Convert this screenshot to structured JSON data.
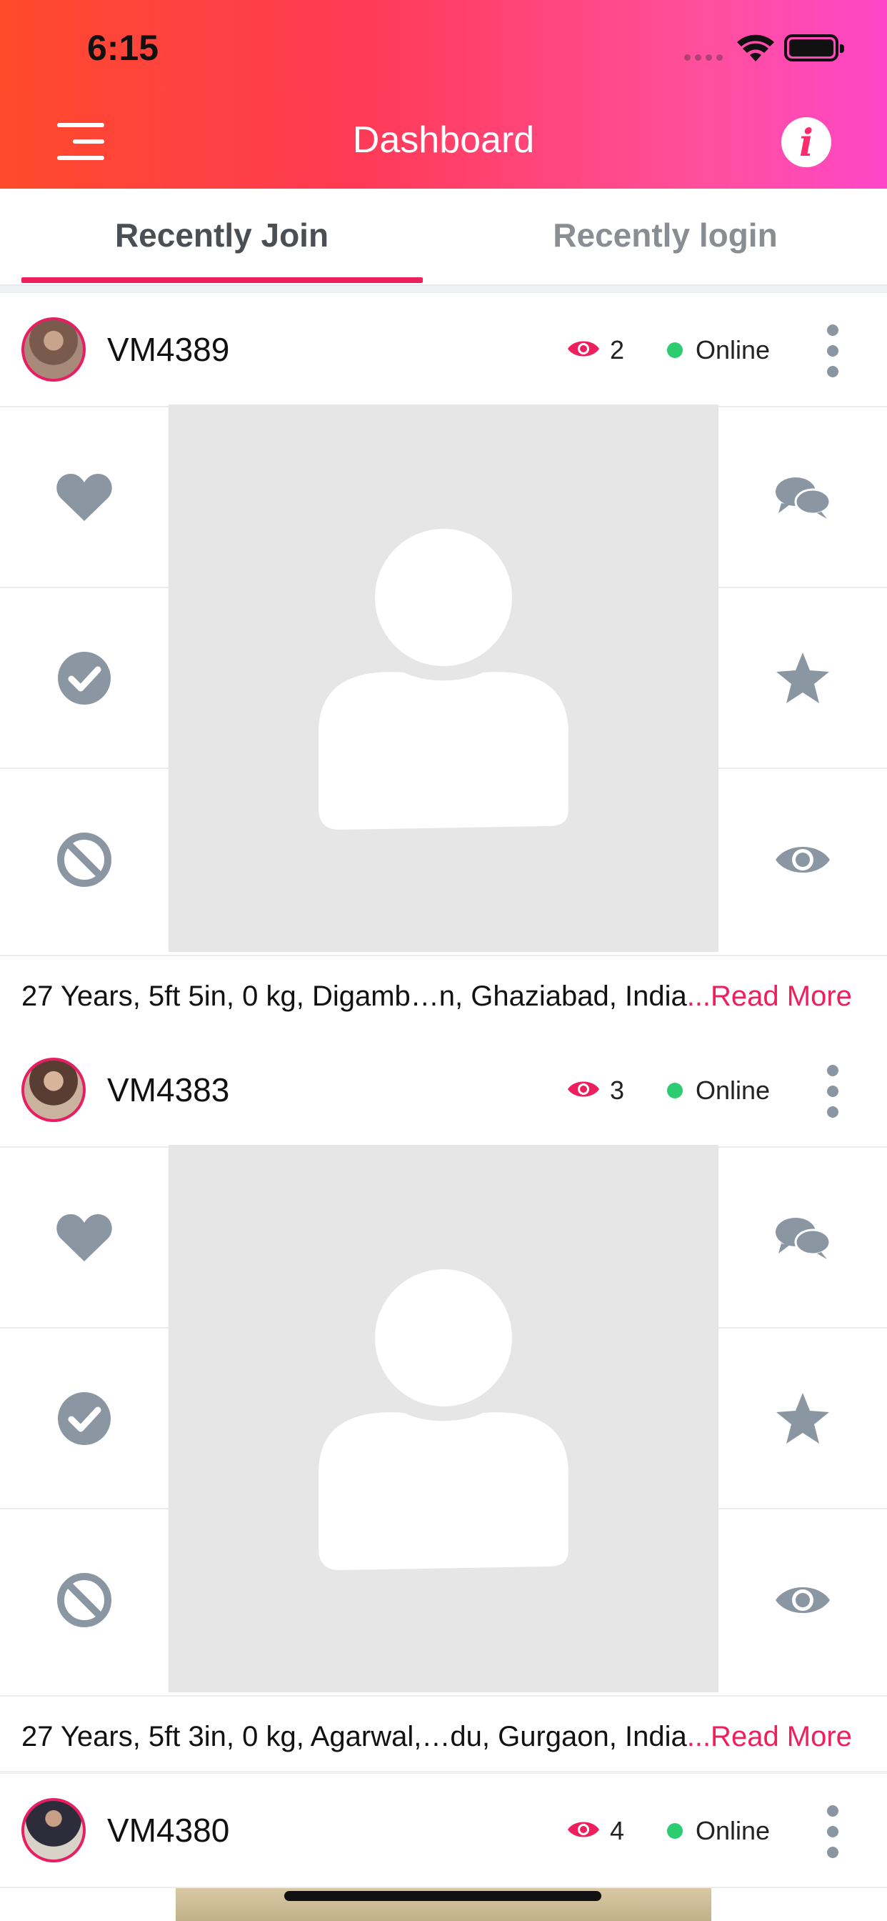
{
  "status_bar": {
    "time": "6:15"
  },
  "header": {
    "title": "Dashboard",
    "menu_icon": "hamburger-menu-icon",
    "info_icon": "info-icon",
    "info_glyph": "i"
  },
  "tabs": [
    {
      "label": "Recently Join",
      "active": true
    },
    {
      "label": "Recently login",
      "active": false
    }
  ],
  "colors": {
    "accent": "#ee1f5c",
    "online": "#2ecc71",
    "icon_gray": "#8a97a3"
  },
  "profiles": [
    {
      "code": "VM4389",
      "views": "2",
      "status": "Online",
      "description": "27 Years, 5ft 5in, 0 kg, Digamb…n, Ghaziabad, India",
      "read_more": "...Read More"
    },
    {
      "code": "VM4383",
      "views": "3",
      "status": "Online",
      "description": "27 Years, 5ft 3in, 0 kg, Agarwal,…du, Gurgaon, India",
      "read_more": "...Read More"
    },
    {
      "code": "VM4380",
      "views": "4",
      "status": "Online"
    }
  ]
}
